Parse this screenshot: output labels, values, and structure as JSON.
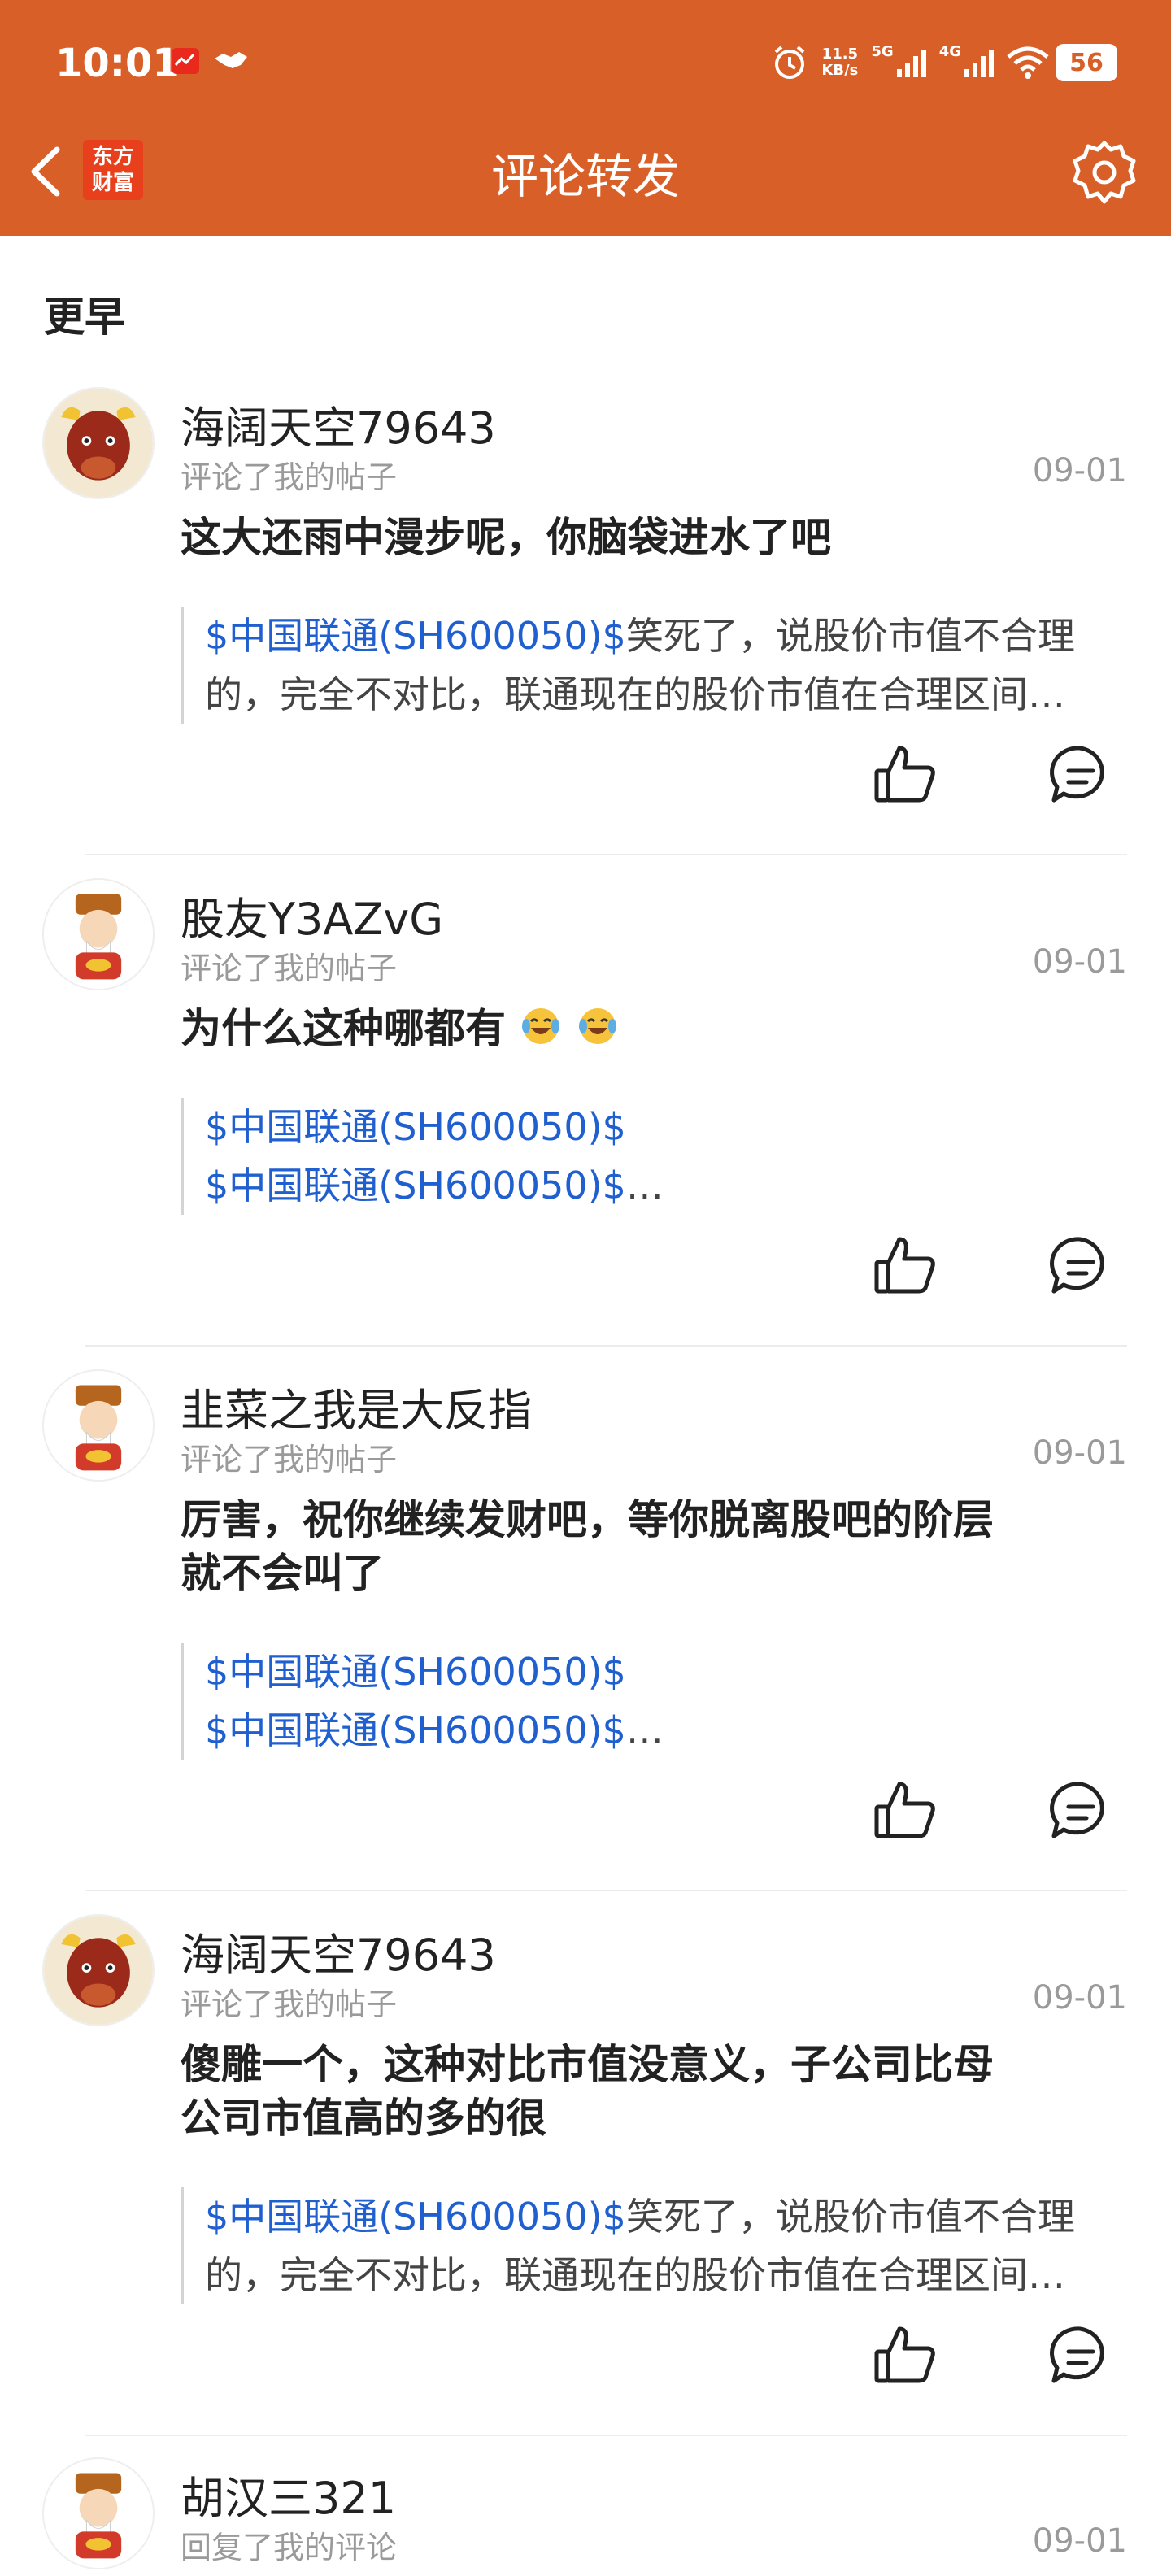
{
  "status_bar": {
    "time": "10:01",
    "net_speed_value": "11.5",
    "net_speed_unit": "KB/s",
    "signal_1": "5G",
    "signal_2": "4G",
    "battery": "56"
  },
  "header": {
    "title": "评论转发",
    "logo_line1": "东方",
    "logo_line2": "财富"
  },
  "section": {
    "title": "更早"
  },
  "items": [
    {
      "username": "海阔天空79643",
      "action": "评论了我的帖子",
      "date": "09-01",
      "comment": "这大还雨中漫步呢，你脑袋进水了吧",
      "quote_line1_stock": "$中国联通(SH600050)$",
      "quote_line1_text": "笑死了，说股价市值不合理",
      "quote_line2_stock": "",
      "quote_line2_text": "的，完全不对比，联通现在的股价市值在合理区间…"
    },
    {
      "username": "股友Y3AZvG",
      "action": "评论了我的帖子",
      "date": "09-01",
      "comment": "为什么这种哪都有",
      "quote_line1_stock": "$中国联通(SH600050)$",
      "quote_line1_text": "",
      "quote_line2_stock": "$中国联通(SH600050)$",
      "quote_line2_text": "…"
    },
    {
      "username": "韭菜之我是大反指",
      "action": "评论了我的帖子",
      "date": "09-01",
      "comment_line1": "厉害，祝你继续发财吧，等你脱离股吧的阶层",
      "comment_line2": "就不会叫了",
      "quote_line1_stock": "$中国联通(SH600050)$",
      "quote_line1_text": "",
      "quote_line2_stock": "$中国联通(SH600050)$",
      "quote_line2_text": "…"
    },
    {
      "username": "海阔天空79643",
      "action": "评论了我的帖子",
      "date": "09-01",
      "comment_line1": "傻雕一个，这种对比市值没意义，子公司比母",
      "comment_line2": "公司市值高的多的很",
      "quote_line1_stock": "$中国联通(SH600050)$",
      "quote_line1_text": "笑死了，说股价市值不合理",
      "quote_line2_stock": "",
      "quote_line2_text": "的，完全不对比，联通现在的股价市值在合理区间…"
    },
    {
      "username": "胡汉三321",
      "action": "回复了我的评论",
      "date": "09-01"
    }
  ],
  "icons": {
    "back": "chevron-left-icon",
    "settings": "gear-icon",
    "like": "thumbs-up-icon",
    "reply": "comment-bubble-icon",
    "emoji": "laughing-crying-emoji"
  },
  "colors": {
    "header_bg": "#D95F28",
    "stock_link": "#1F5FCF",
    "secondary_text": "#9a9a9a"
  }
}
